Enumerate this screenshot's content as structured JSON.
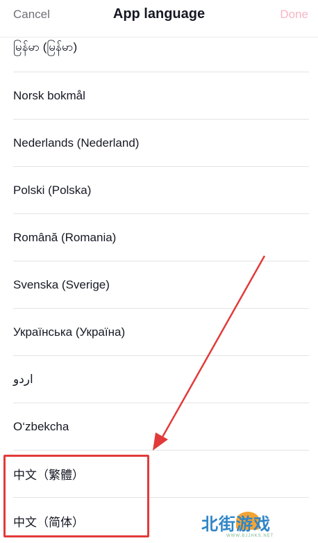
{
  "header": {
    "cancel_label": "Cancel",
    "title": "App language",
    "done_label": "Done"
  },
  "languages": [
    {
      "label": "မြန်မာ (မြန်မာ)"
    },
    {
      "label": "Norsk bokmål"
    },
    {
      "label": "Nederlands (Nederland)"
    },
    {
      "label": "Polski (Polska)"
    },
    {
      "label": "Română (Romania)"
    },
    {
      "label": "Svenska (Sverige)"
    },
    {
      "label": "Українська (Україна)"
    },
    {
      "label": "اردو"
    },
    {
      "label": "O‘zbekcha"
    },
    {
      "label": "中文（繁體）"
    },
    {
      "label": "中文（简体）"
    }
  ],
  "colors": {
    "done_disabled": "#f7b6c2",
    "annotation_red": "#e23a3a"
  },
  "watermark": {
    "text": "北街游戏",
    "url": "WWW.BJJHKS.NET"
  }
}
